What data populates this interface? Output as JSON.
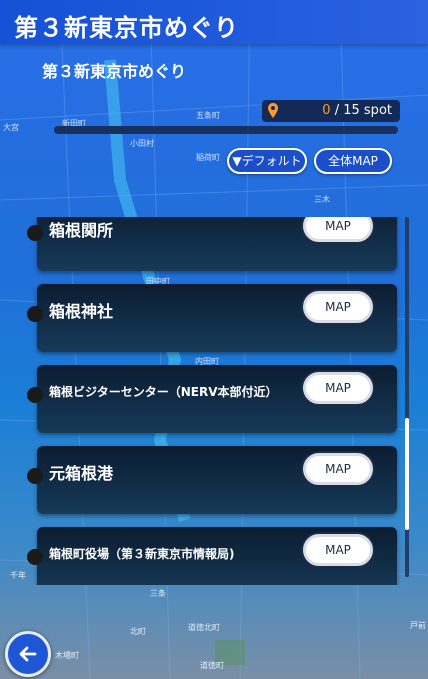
{
  "header": {
    "title": "第３新東京市めぐり"
  },
  "course": {
    "subtitle": "第３新東京市めぐり"
  },
  "progress": {
    "current": "0",
    "separator": " / ",
    "total": "15",
    "unit": " spot",
    "fraction": 0.0
  },
  "filters": {
    "default_label": "▼デフォルト",
    "all_map_label": "全体MAP"
  },
  "spots": [
    {
      "name": "箱根関所",
      "map_label": "MAP"
    },
    {
      "name": "箱根神社",
      "map_label": "MAP"
    },
    {
      "name": "箱根ビジターセンター（NERV本部付近）",
      "map_label": "MAP"
    },
    {
      "name": "元箱根港",
      "map_label": "MAP"
    },
    {
      "name": "箱根町役場（第３新東京市情報局)",
      "map_label": "MAP"
    }
  ],
  "map_labels": [
    "新田町",
    "大宮",
    "五条町",
    "小田村",
    "稲荷町",
    "田中町",
    "内田町",
    "三木",
    "千年",
    "道徳北町",
    "木場町",
    "道徳町",
    "北町",
    "三条",
    "戸前"
  ],
  "icons": {
    "back": "back-arrow-icon",
    "pin": "map-pin-icon"
  },
  "colors": {
    "accent": "#ff9a2e",
    "header": "#1551d6"
  }
}
